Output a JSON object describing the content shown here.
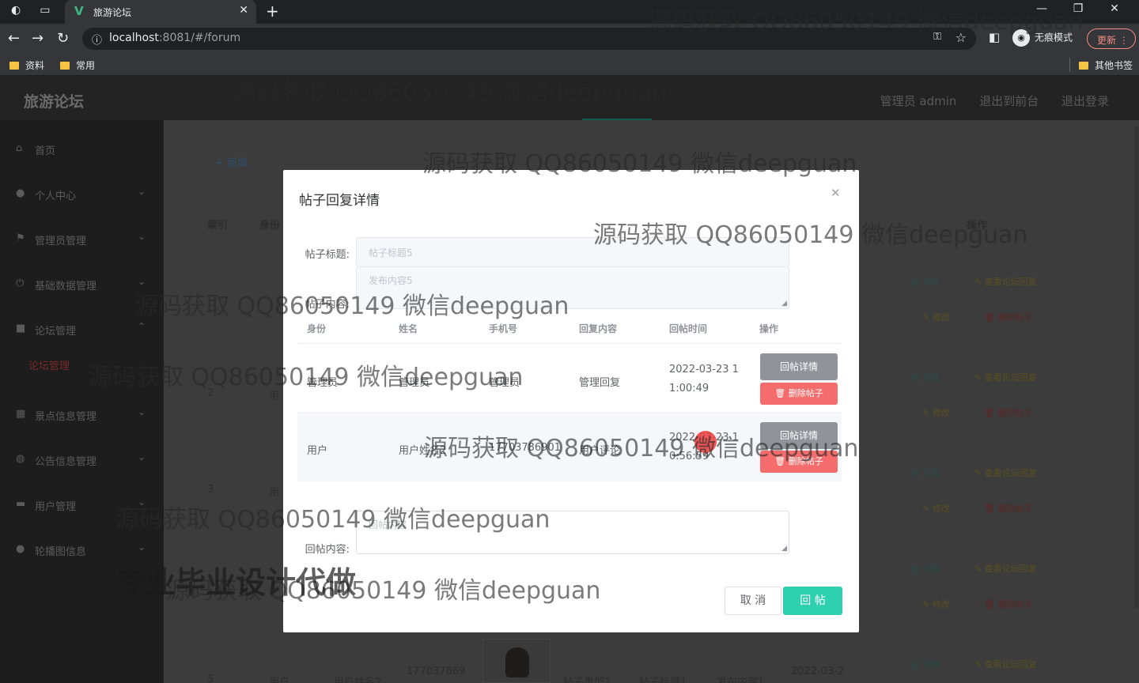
{
  "browser": {
    "tab_title": "旅游论坛",
    "url_host": "localhost",
    "url_rest": ":8081/#/forum",
    "incognito_label": "无痕模式",
    "update_label": "更新",
    "bookmarks": [
      "资料",
      "常用"
    ],
    "other_bookmarks": "其他书签"
  },
  "app": {
    "logo": "旅游论坛",
    "header_links": [
      "管理员 admin",
      "退出到前台",
      "退出登录"
    ]
  },
  "sidebar": {
    "items": [
      {
        "label": "首页",
        "icon": "home-icon"
      },
      {
        "label": "个人中心",
        "icon": "user-icon"
      },
      {
        "label": "管理员管理",
        "icon": "flag-icon"
      },
      {
        "label": "基础数据管理",
        "icon": "power-icon"
      },
      {
        "label": "论坛管理",
        "icon": "lock-icon"
      },
      {
        "label": "景点信息管理",
        "icon": "grid-icon"
      },
      {
        "label": "公告信息管理",
        "icon": "globe-icon"
      },
      {
        "label": "用户管理",
        "icon": "folder-icon"
      },
      {
        "label": "轮播图信息",
        "icon": "user-icon"
      }
    ],
    "active_sub": "论坛管理"
  },
  "background": {
    "add_label": "+ 新增",
    "headers": [
      "索引",
      "身份",
      "操作"
    ],
    "rows": [
      {
        "index": "2",
        "role": "用"
      },
      {
        "index": "3",
        "role": "用"
      },
      {
        "index": "5",
        "role": "用户",
        "name": "用户姓名2",
        "phone": "177037869",
        "type": "帖子类型2",
        "title": "帖子标题1",
        "content": "发布内容1",
        "time": "2022-03-2"
      }
    ],
    "actions": {
      "detail": "详情",
      "view_reply": "查看论坛回复",
      "edit": "修改",
      "delete": "删除帖子"
    }
  },
  "dialog": {
    "title": "帖子回复详情",
    "post_title_label": "帖子标题:",
    "post_title_value": "帖子标题5",
    "post_content_label": "帖子内容:",
    "post_content_value": "发布内容5",
    "columns": [
      "身份",
      "姓名",
      "手机号",
      "回复内容",
      "回帖时间",
      "操作"
    ],
    "replies": [
      {
        "role": "管理员",
        "name": "管理员",
        "phone": "管理员",
        "content": "管理回复",
        "time1": "2022-03-23 1",
        "time2": "1:00:49"
      },
      {
        "role": "用户",
        "name": "用户姓名2",
        "phone": "17703786901",
        "content": "用户评论",
        "time1": "2022-03-23 1",
        "time2": "0:56:59"
      }
    ],
    "detail_btn": "回帖详情",
    "delete_btn": "删除帖子",
    "reply_label": "回帖内容:",
    "reply_placeholder": "回帖内容",
    "cancel_btn": "取 消",
    "submit_btn": "回 帖"
  },
  "watermark": {
    "text": "源码获取 QQ86050149 微信deepguan",
    "big": "专业毕业设计代做"
  }
}
